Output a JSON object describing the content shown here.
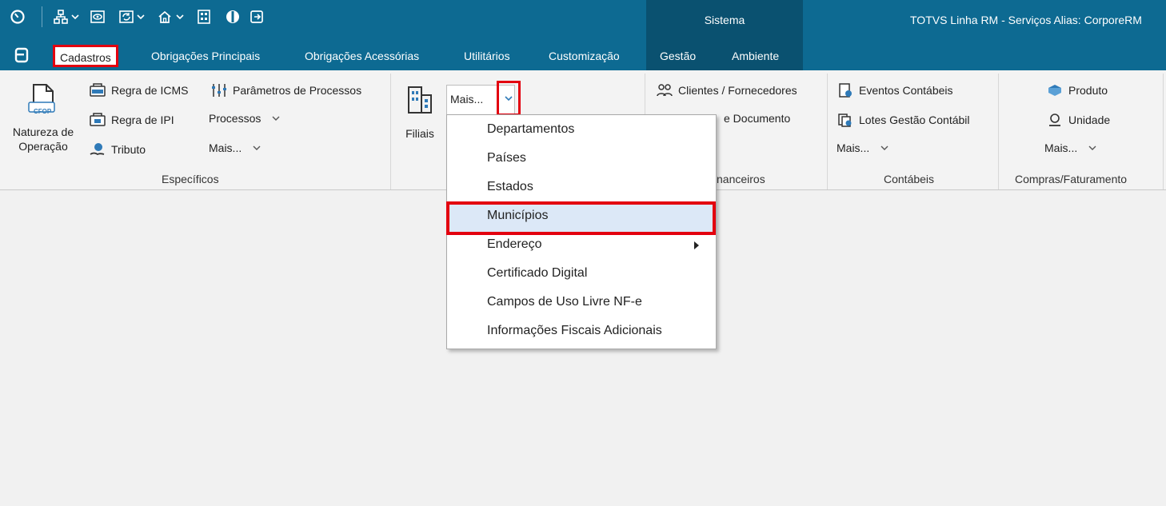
{
  "window": {
    "title": "TOTVS Linha RM - Serviços  Alias: CorporeRM"
  },
  "context_tab": {
    "label": "Sistema"
  },
  "quick_access": {
    "icons": [
      "power-icon",
      "org-chart-icon",
      "chevron-down-icon",
      "eye-icon",
      "refresh-icon",
      "chevron-down-icon",
      "home-icon",
      "chevron-down-icon",
      "calculator-icon",
      "totvs-logo-icon",
      "exit-icon"
    ]
  },
  "tabs": [
    {
      "label": "Cadastros",
      "active": true
    },
    {
      "label": "Obrigações Principais"
    },
    {
      "label": "Obrigações Acessórias"
    },
    {
      "label": "Utilitários"
    },
    {
      "label": "Customização"
    },
    {
      "label": "Gestão"
    },
    {
      "label": "Ambiente"
    }
  ],
  "ribbon": {
    "especificos": {
      "label": "Específicos",
      "natureza_line1": "Natureza de",
      "natureza_line2": "Operação",
      "cfop_badge": "CFOP",
      "regra_icms": "Regra de ICMS",
      "regra_ipi": "Regra de IPI",
      "tributo": "Tributo",
      "parametros": "Parâmetros de Processos",
      "processos": "Processos",
      "mais": "Mais..."
    },
    "filiais": {
      "label": "Filiais",
      "combo_value": "Mais..."
    },
    "financeiros": {
      "label_partial": "nanceiros",
      "clientes": "Clientes / Fornecedores",
      "doc_partial": "e Documento"
    },
    "contabeis": {
      "label": "Contábeis",
      "eventos": "Eventos Contábeis",
      "lotes": "Lotes Gestão Contábil",
      "mais": "Mais..."
    },
    "compras": {
      "label": "Compras/Faturamento",
      "produto": "Produto",
      "unidade": "Unidade",
      "mais": "Mais..."
    }
  },
  "dropdown": {
    "items": [
      {
        "label": "Departamentos"
      },
      {
        "label": "Países"
      },
      {
        "label": "Estados"
      },
      {
        "label": "Municípios",
        "highlighted": true
      },
      {
        "label": "Endereço",
        "submenu": true
      },
      {
        "label": "Certificado Digital"
      },
      {
        "label": "Campos de Uso Livre NF-e"
      },
      {
        "label": "Informações Fiscais Adicionais"
      }
    ]
  },
  "colors": {
    "titlebar": "#0d6a92",
    "context_block": "#0a5170",
    "highlight_border": "#e3000f",
    "hover_fill": "#dce8f7"
  }
}
